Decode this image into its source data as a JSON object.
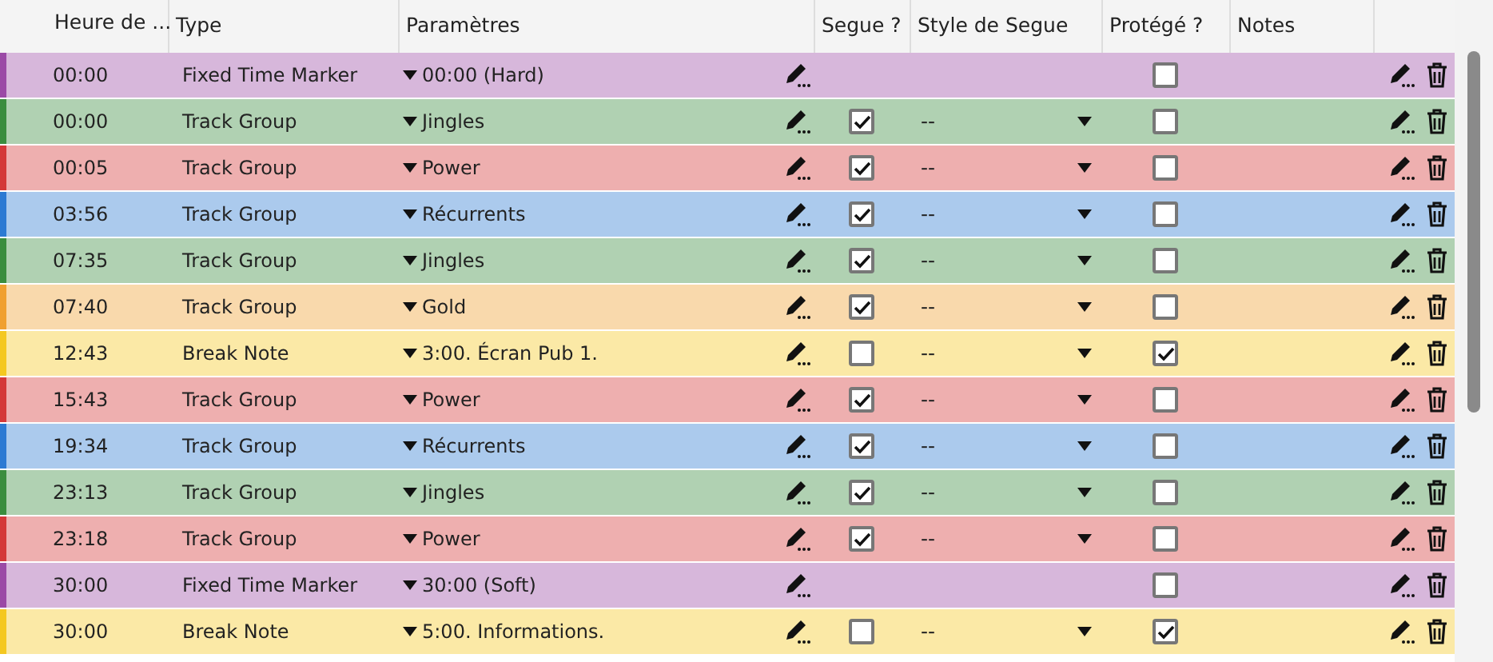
{
  "columns": [
    "Heure de ...",
    "Type",
    "Paramètres",
    "Segue ?",
    "Style de Segue",
    "Protégé ?",
    "Notes"
  ],
  "rows": [
    {
      "kind": "marker",
      "time": "00:00",
      "type": "Fixed Time Marker",
      "params": "00:00 (Hard)",
      "color": "#9b4aa6",
      "protected": false
    },
    {
      "kind": "group",
      "time": "00:00",
      "type": "Track Group",
      "params": "Jingles",
      "color": "#3a8d3e",
      "segue": true,
      "segue_style": "--",
      "protected": false
    },
    {
      "kind": "group",
      "time": "00:05",
      "type": "Track Group",
      "params": "Power",
      "color": "#d43838",
      "segue": true,
      "segue_style": "--",
      "protected": false
    },
    {
      "kind": "group",
      "time": "03:56",
      "type": "Track Group",
      "params": "Récurrents",
      "color": "#2c7ad3",
      "segue": true,
      "segue_style": "--",
      "protected": false
    },
    {
      "kind": "group",
      "time": "07:35",
      "type": "Track Group",
      "params": "Jingles",
      "color": "#3a8d3e",
      "segue": true,
      "segue_style": "--",
      "protected": false
    },
    {
      "kind": "group",
      "time": "07:40",
      "type": "Track Group",
      "params": "Gold",
      "color": "#f0a030",
      "segue": true,
      "segue_style": "--",
      "protected": false
    },
    {
      "kind": "note",
      "time": "12:43",
      "type": "Break Note",
      "params": "3:00. Écran Pub 1.",
      "color": "#f4c820",
      "segue": false,
      "segue_style": "--",
      "protected": true
    },
    {
      "kind": "group",
      "time": "15:43",
      "type": "Track Group",
      "params": "Power",
      "color": "#d43838",
      "segue": true,
      "segue_style": "--",
      "protected": false
    },
    {
      "kind": "group",
      "time": "19:34",
      "type": "Track Group",
      "params": "Récurrents",
      "color": "#2c7ad3",
      "segue": true,
      "segue_style": "--",
      "protected": false
    },
    {
      "kind": "group",
      "time": "23:13",
      "type": "Track Group",
      "params": "Jingles",
      "color": "#3a8d3e",
      "segue": true,
      "segue_style": "--",
      "protected": false
    },
    {
      "kind": "group",
      "time": "23:18",
      "type": "Track Group",
      "params": "Power",
      "color": "#d43838",
      "segue": true,
      "segue_style": "--",
      "protected": false
    },
    {
      "kind": "marker",
      "time": "30:00",
      "type": "Fixed Time Marker",
      "params": "30:00 (Soft)",
      "color": "#9b4aa6",
      "protected": false
    },
    {
      "kind": "note",
      "time": "30:00",
      "type": "Break Note",
      "params": "5:00. Informations.",
      "color": "#f4c820",
      "segue": false,
      "segue_style": "--",
      "protected": true
    }
  ]
}
